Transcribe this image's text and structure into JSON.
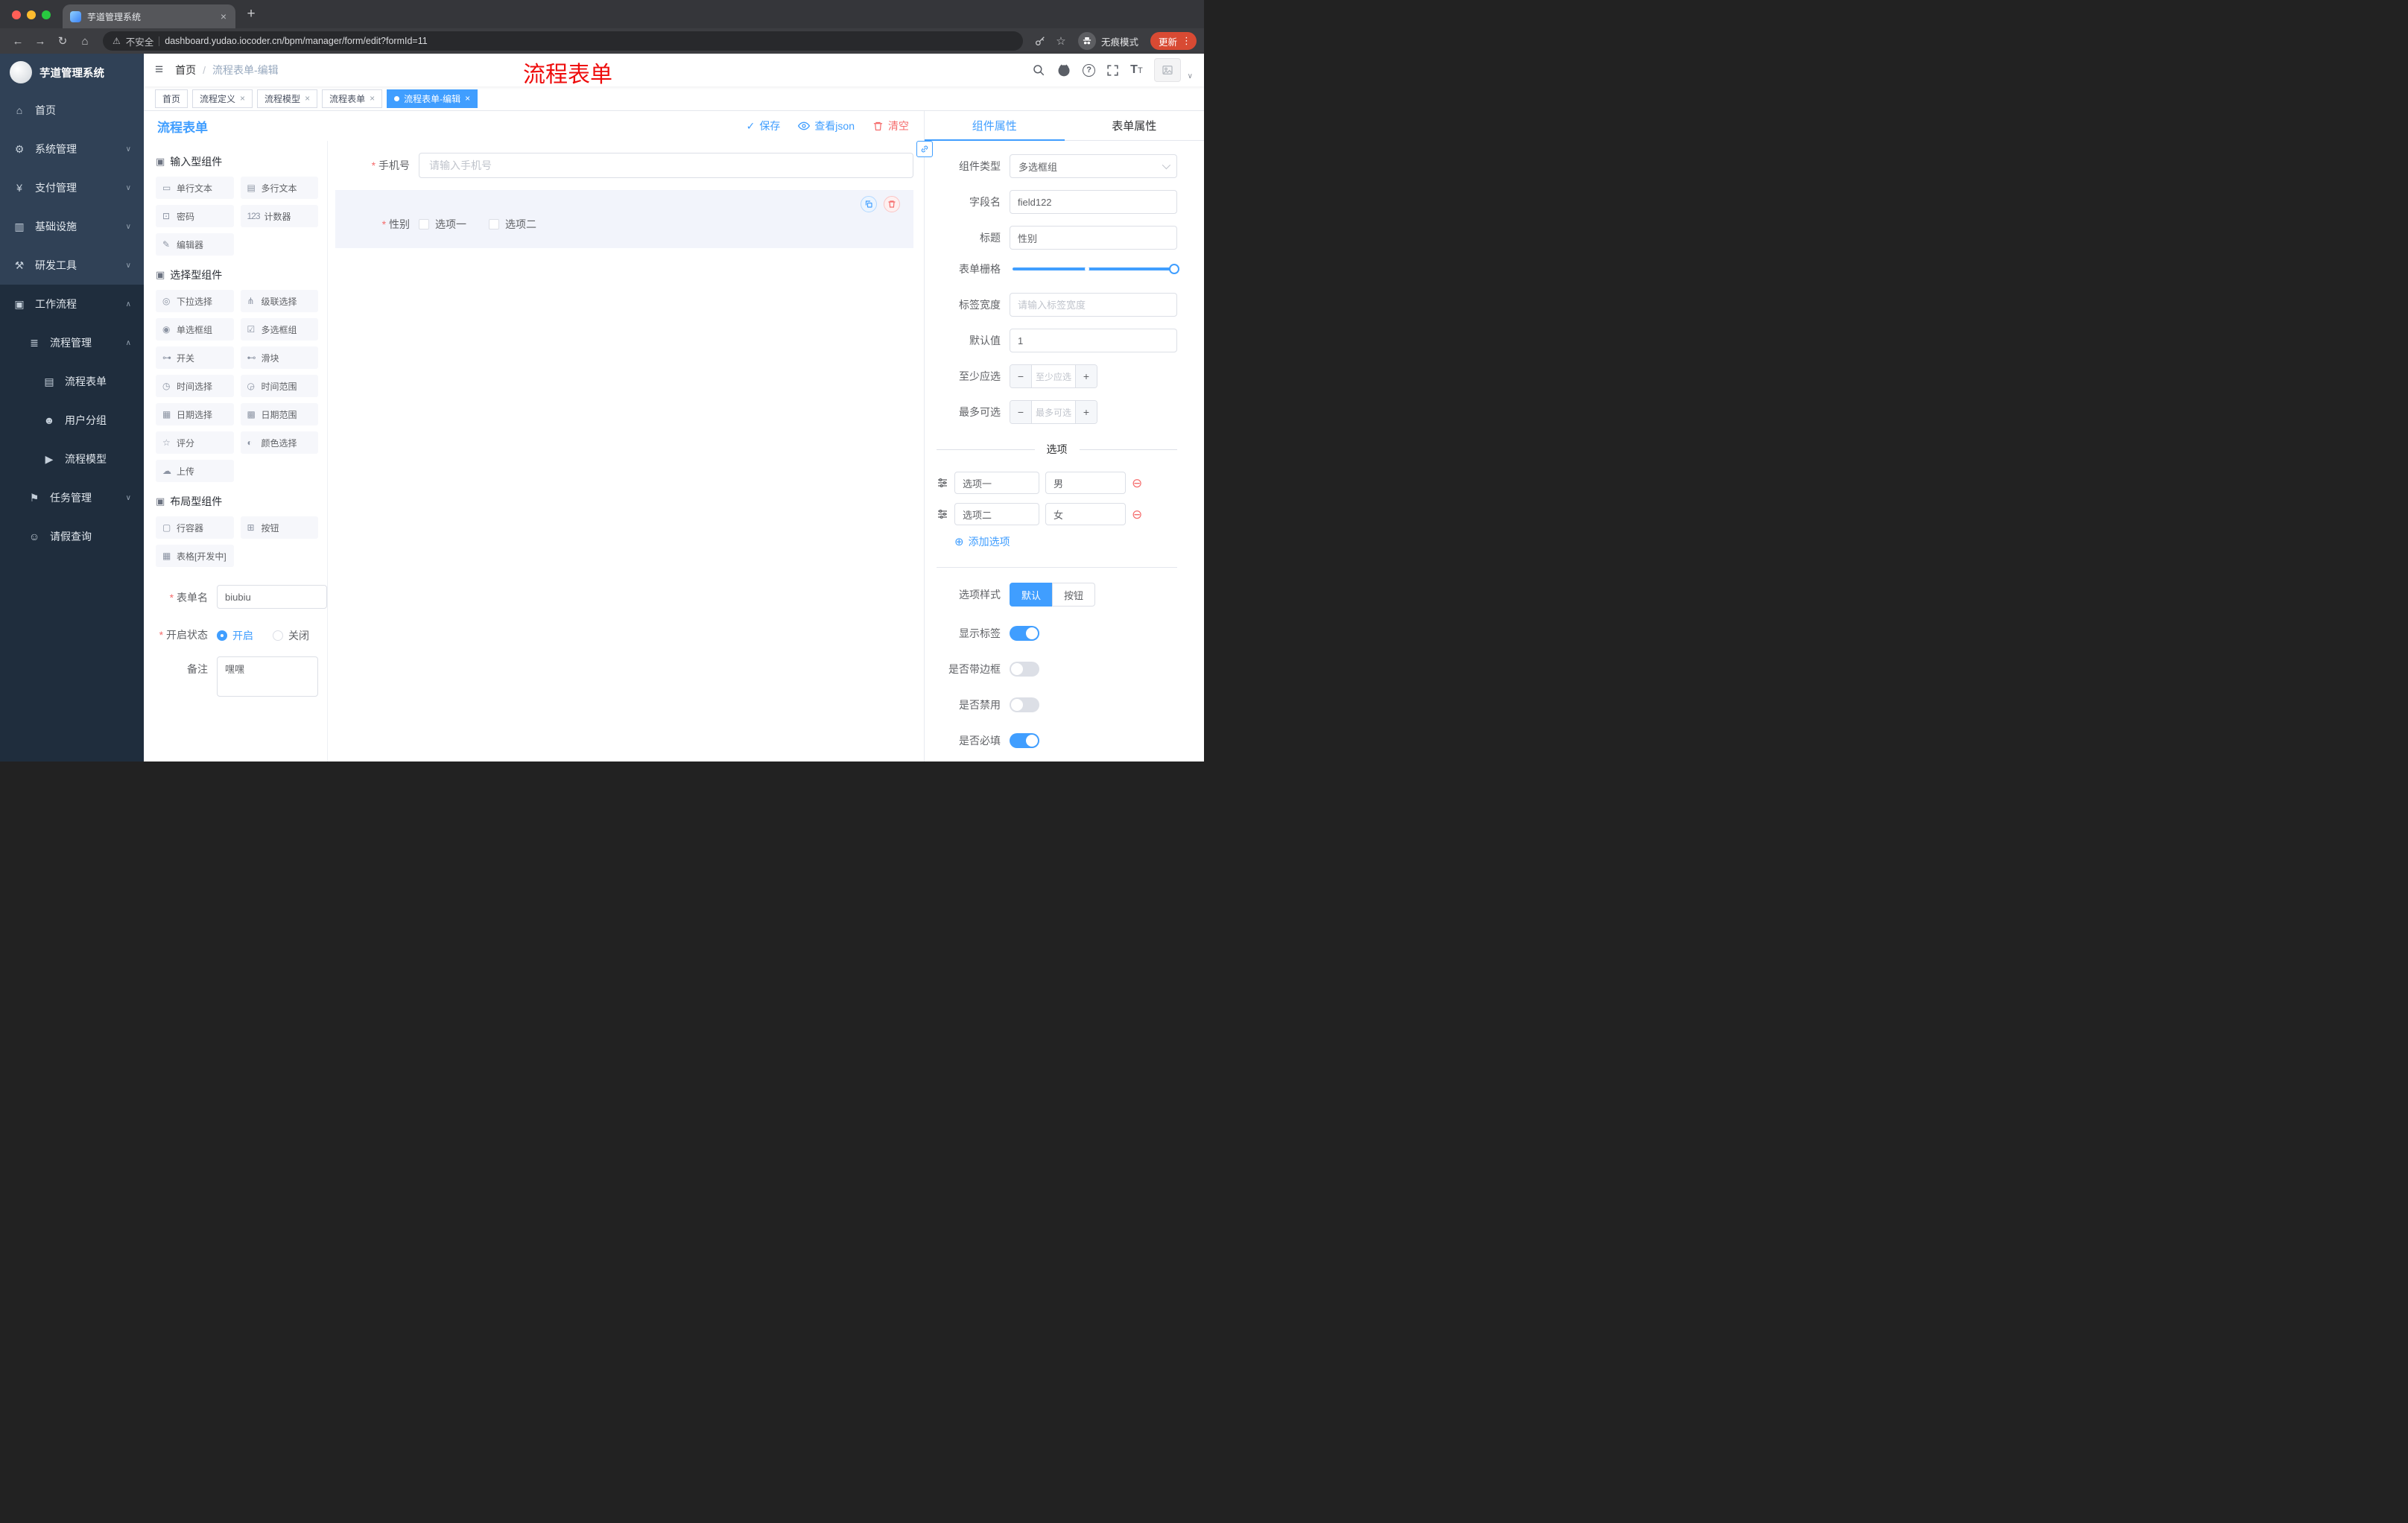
{
  "browser": {
    "tab_title": "芋道管理系统",
    "security_label": "不安全",
    "url": "dashboard.yudao.iocoder.cn/bpm/manager/form/edit?formId=11",
    "incognito_label": "无痕模式",
    "update_label": "更新"
  },
  "glyphs": {
    "back": "←",
    "forward": "→",
    "reload": "↻",
    "home": "⌂",
    "warning": "⚠",
    "star": "☆",
    "dots": "⋮",
    "plus": "+",
    "close": "×",
    "hamburger": "≡",
    "menu_down": "∨",
    "menu_up": "∧",
    "check": "✓",
    "remove_option": "⊖",
    "add_option": "⊕",
    "question": "?",
    "t_big": "T",
    "t_small": "T"
  },
  "sidebar": {
    "logo_title": "芋道管理系统",
    "items": [
      {
        "label": "首页",
        "glyph": "⌂"
      },
      {
        "label": "系统管理",
        "glyph": "⚙"
      },
      {
        "label": "支付管理",
        "glyph": "¥"
      },
      {
        "label": "基础设施",
        "glyph": "▥"
      },
      {
        "label": "研发工具",
        "glyph": "⚒"
      },
      {
        "label": "工作流程",
        "glyph": "▣"
      },
      {
        "label": "流程管理",
        "glyph": "≣"
      },
      {
        "label": "流程表单",
        "glyph": "▤"
      },
      {
        "label": "用户分组",
        "glyph": "☻"
      },
      {
        "label": "流程模型",
        "glyph": "▶"
      },
      {
        "label": "任务管理",
        "glyph": "⚑"
      },
      {
        "label": "请假查询",
        "glyph": "☺"
      }
    ]
  },
  "header": {
    "breadcrumb_home": "首页",
    "breadcrumb_sep": "/",
    "breadcrumb_current": "流程表单-编辑",
    "overlay_title": "流程表单"
  },
  "tags": [
    {
      "label": "首页"
    },
    {
      "label": "流程定义"
    },
    {
      "label": "流程模型"
    },
    {
      "label": "流程表单"
    },
    {
      "label": "流程表单-编辑"
    }
  ],
  "designer": {
    "title": "流程表单",
    "save_label": "保存",
    "view_json_label": "查看json",
    "clear_label": "清空",
    "sections": [
      {
        "title": "输入型组件",
        "glyph": "▣"
      },
      {
        "title": "选择型组件",
        "glyph": "▣"
      },
      {
        "title": "布局型组件",
        "glyph": "▣"
      }
    ],
    "palette_input": [
      {
        "label": "单行文本",
        "glyph": "▭"
      },
      {
        "label": "多行文本",
        "glyph": "▤"
      },
      {
        "label": "密码",
        "glyph": "⊡"
      },
      {
        "label": "计数器",
        "glyph": "123"
      },
      {
        "label": "编辑器",
        "glyph": "✎"
      }
    ],
    "palette_select": [
      {
        "label": "下拉选择",
        "glyph": "◎"
      },
      {
        "label": "级联选择",
        "glyph": "⋔"
      },
      {
        "label": "单选框组",
        "glyph": "◉"
      },
      {
        "label": "多选框组",
        "glyph": "☑"
      },
      {
        "label": "开关",
        "glyph": "⊶"
      },
      {
        "label": "滑块",
        "glyph": "⊷"
      },
      {
        "label": "时间选择",
        "glyph": "◷"
      },
      {
        "label": "时间范围",
        "glyph": "◶"
      },
      {
        "label": "日期选择",
        "glyph": "▦"
      },
      {
        "label": "日期范围",
        "glyph": "▩"
      },
      {
        "label": "评分",
        "glyph": "☆"
      },
      {
        "label": "颜色选择",
        "glyph": "◐"
      },
      {
        "label": "上传",
        "glyph": "☁"
      }
    ],
    "palette_layout": [
      {
        "label": "行容器",
        "glyph": "▢"
      },
      {
        "label": "按钮",
        "glyph": "⊞"
      },
      {
        "label": "表格[开发中]",
        "glyph": "▦"
      }
    ],
    "form": {
      "name_label": "表单名",
      "name_value": "biubiu",
      "status_label": "开启状态",
      "status_on": "开启",
      "status_off": "关闭",
      "remark_label": "备注",
      "remark_value": "嘿嘿"
    }
  },
  "canvas": {
    "phone_label": "手机号",
    "phone_placeholder": "请输入手机号",
    "gender_label": "性别",
    "gender_option1": "选项一",
    "gender_option2": "选项二"
  },
  "inspector": {
    "tab_component": "组件属性",
    "tab_form": "表单属性",
    "component_type_label": "组件类型",
    "component_type_value": "多选框组",
    "field_name_label": "字段名",
    "field_name_value": "field122",
    "title_label": "标题",
    "title_value": "性别",
    "grid_label": "表单栅格",
    "label_width_label": "标签宽度",
    "label_width_placeholder": "请输入标签宽度",
    "default_label": "默认值",
    "default_value": "1",
    "min_label": "至少应选",
    "min_placeholder": "至少应选",
    "max_label": "最多可选",
    "max_placeholder": "最多可选",
    "options_divider": "选项",
    "options": [
      {
        "name": "选项一",
        "value": "男"
      },
      {
        "name": "选项二",
        "value": "女"
      }
    ],
    "add_option_label": "添加选项",
    "style_label": "选项样式",
    "style_default": "默认",
    "style_button": "按钮",
    "switch_show_label": "显示标签",
    "switch_border": "是否带边框",
    "switch_disabled": "是否禁用",
    "switch_required": "是否必填"
  }
}
